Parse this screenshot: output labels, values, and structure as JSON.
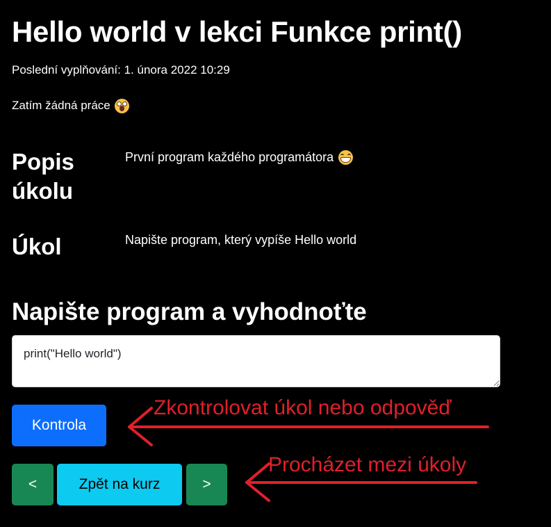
{
  "page": {
    "title": "Hello world v lekci Funkce print()",
    "last_filled": "Poslední vyplňování: 1. února 2022 10:29",
    "no_work": "Zatím žádná práce",
    "no_work_emoji": "astonished-face-emoji"
  },
  "details": {
    "description_heading": "Popis úkolu",
    "description_text": "První program každého programátora",
    "description_emoji": "grinning-face-emoji",
    "task_heading": "Úkol",
    "task_text": "Napište program, který vypíše Hello world"
  },
  "editor": {
    "heading": "Napište program a vyhodnoťte",
    "code": "print(\"Hello world\")"
  },
  "buttons": {
    "check": "Kontrola",
    "prev": "<",
    "back_to_course": "Zpět na kurz",
    "next": ">"
  },
  "annotations": {
    "check_hint": "Zkontrolovat úkol nebo odpověď",
    "navigate_hint": "Procházet mezi úkoly",
    "color": "#e0202a"
  },
  "colors": {
    "background": "#000000",
    "primary": "#0d6efd",
    "success": "#198754",
    "info": "#0dcaf0"
  }
}
